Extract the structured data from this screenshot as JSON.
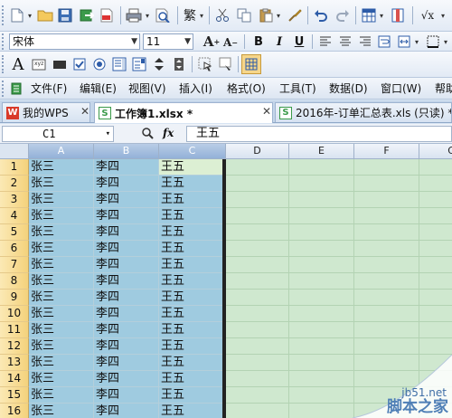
{
  "toolbar": {
    "font_name": "宋体",
    "font_size": "11",
    "bold": "B",
    "italic": "I",
    "underline": "U",
    "big_a": "A",
    "small_a": "A",
    "traditional": "繁",
    "text_a": "A"
  },
  "menu": {
    "items": [
      "文件(F)",
      "编辑(E)",
      "视图(V)",
      "插入(I)",
      "格式(O)",
      "工具(T)",
      "数据(D)",
      "窗口(W)",
      "帮助"
    ]
  },
  "tabs": [
    {
      "label": "我的WPS",
      "icon": "wps-icon"
    },
    {
      "label": "工作簿1.xlsx *",
      "icon": "spreadsheet-icon"
    },
    {
      "label": "2016年-订单汇总表.xls (只读) *",
      "icon": "spreadsheet-icon"
    }
  ],
  "formula_bar": {
    "name_box": "C1",
    "fx": "fx",
    "value": "王五"
  },
  "grid": {
    "columns": [
      "A",
      "B",
      "C",
      "D",
      "E",
      "F",
      "G"
    ],
    "rows": [
      [
        "1",
        "张三",
        "李四",
        "王五"
      ],
      [
        "2",
        "张三",
        "李四",
        "王五"
      ],
      [
        "3",
        "张三",
        "李四",
        "王五"
      ],
      [
        "4",
        "张三",
        "李四",
        "王五"
      ],
      [
        "5",
        "张三",
        "李四",
        "王五"
      ],
      [
        "6",
        "张三",
        "李四",
        "王五"
      ],
      [
        "7",
        "张三",
        "李四",
        "王五"
      ],
      [
        "8",
        "张三",
        "李四",
        "王五"
      ],
      [
        "9",
        "张三",
        "李四",
        "王五"
      ],
      [
        "10",
        "张三",
        "李四",
        "王五"
      ],
      [
        "11",
        "张三",
        "李四",
        "王五"
      ],
      [
        "12",
        "张三",
        "李四",
        "王五"
      ],
      [
        "13",
        "张三",
        "李四",
        "王五"
      ],
      [
        "14",
        "张三",
        "李四",
        "王五"
      ],
      [
        "15",
        "张三",
        "李四",
        "王五"
      ],
      [
        "16",
        "张三",
        "李四",
        "王五"
      ]
    ],
    "selection_color": "#9fcbe0",
    "background_color": "#cfe8cf"
  },
  "watermark": {
    "line1": "jb51.net",
    "line2": "脚本之家"
  }
}
